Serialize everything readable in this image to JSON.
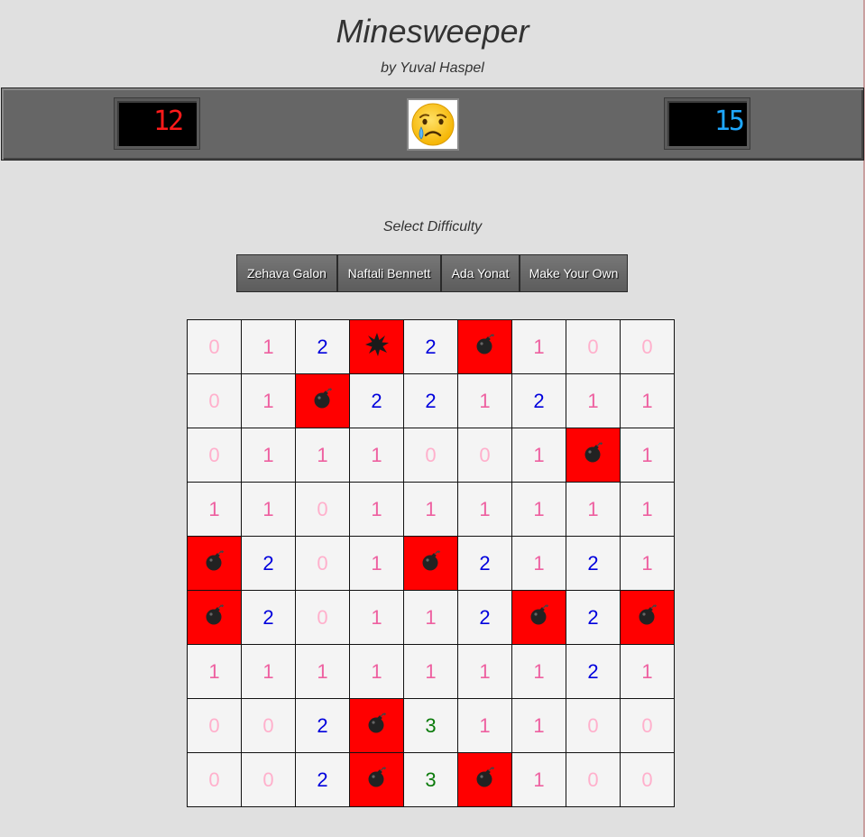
{
  "header": {
    "title": "Minesweeper",
    "subtitle": "by Yuval Haspel"
  },
  "status": {
    "mine_counter": "12",
    "timer": "15",
    "face": "crying-face"
  },
  "difficulty": {
    "label": "Select Difficulty",
    "options": [
      "Zehava Galon",
      "Naftali Bennett",
      "Ada Yonat",
      "Make Your Own"
    ]
  },
  "colors": {
    "mine_counter": "#ff1a1a",
    "timer": "#1ea7ff",
    "revealed_mine_bg": "#ff0000",
    "n0": "#ffb0cc",
    "n1": "#ee60a0",
    "n2": "#0000dd",
    "n3": "#0a7a0a"
  },
  "board": {
    "rows": 9,
    "cols": 9,
    "cells": [
      [
        "0",
        "1",
        "2",
        "X",
        "2",
        "B",
        "1",
        "0",
        "0"
      ],
      [
        "0",
        "1",
        "B",
        "2",
        "2",
        "1",
        "2",
        "1",
        "1"
      ],
      [
        "0",
        "1",
        "1",
        "1",
        "0",
        "0",
        "1",
        "B",
        "1"
      ],
      [
        "1",
        "1",
        "0",
        "1",
        "1",
        "1",
        "1",
        "1",
        "1"
      ],
      [
        "B",
        "2",
        "0",
        "1",
        "B",
        "2",
        "1",
        "2",
        "1"
      ],
      [
        "B",
        "2",
        "0",
        "1",
        "1",
        "2",
        "B",
        "2",
        "B"
      ],
      [
        "1",
        "1",
        "1",
        "1",
        "1",
        "1",
        "1",
        "2",
        "1"
      ],
      [
        "0",
        "0",
        "2",
        "B",
        "3",
        "1",
        "1",
        "0",
        "0"
      ],
      [
        "0",
        "0",
        "2",
        "B",
        "3",
        "B",
        "1",
        "0",
        "0"
      ]
    ],
    "legend": {
      "B": "bomb-icon",
      "X": "explosion-icon"
    }
  }
}
